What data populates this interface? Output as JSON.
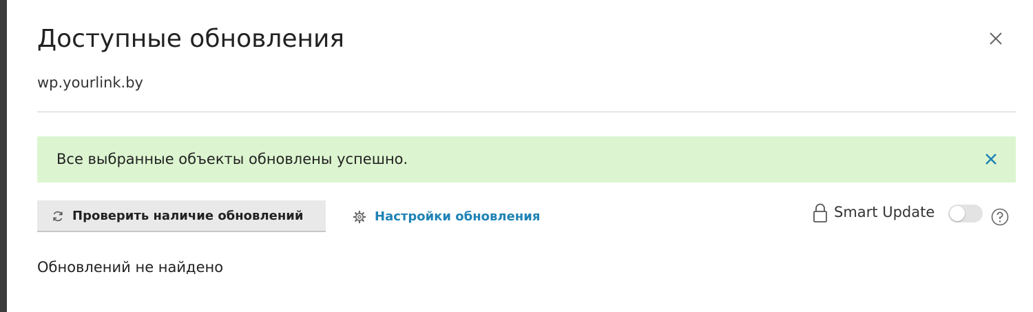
{
  "dialog": {
    "title": "Доступные обновления",
    "subtitle": "wp.yourlink.by",
    "close_icon": "close-icon"
  },
  "alert": {
    "message": "Все выбранные объекты обновлены успешно.",
    "background": "#dcf5d0",
    "close_color": "#1f83b5"
  },
  "toolbar": {
    "check_updates_label": "Проверить наличие обновлений",
    "check_updates_icon": "refresh-icon",
    "settings_label": "Настройки обновления",
    "settings_icon": "gear-icon",
    "link_color": "#1f83b5"
  },
  "smart_update": {
    "label": "Smart Update",
    "enabled": false,
    "lock_icon": "lock-icon",
    "help_icon": "help-icon"
  },
  "result": {
    "message": "Обновлений не найдено"
  }
}
